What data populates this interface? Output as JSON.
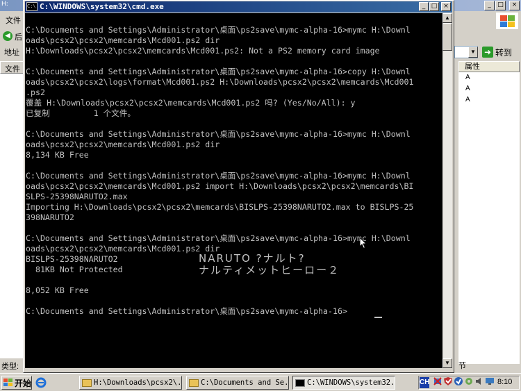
{
  "background_window": {
    "title_fragment": "H:",
    "menu_fragment": "文件",
    "back_fragment": "后",
    "address_label": "地址",
    "file_column": "文件",
    "attr_column": "属性",
    "attr_values": [
      "A",
      "A",
      "A"
    ],
    "go_label": "转到",
    "type_label": "类型:",
    "status_fragment": "节",
    "controls": [
      "_",
      "□",
      "×"
    ]
  },
  "cmd_window": {
    "title": "C:\\WINDOWS\\system32\\cmd.exe",
    "controls": [
      "_",
      "□",
      "×"
    ],
    "lines": [
      "C:\\Documents and Settings\\Administrator\\桌面\\ps2save\\mymc-alpha-16>mymc H:\\Downl",
      "oads\\pcsx2\\pcsx2\\memcards\\Mcd001.ps2 dir",
      "H:\\Downloads\\pcsx2\\pcsx2\\memcards\\Mcd001.ps2: Not a PS2 memory card image",
      "",
      "C:\\Documents and Settings\\Administrator\\桌面\\ps2save\\mymc-alpha-16>copy H:\\Downl",
      "oads\\pcsx2\\pcsx2\\logs\\format\\Mcd001.ps2 H:\\Downloads\\pcsx2\\pcsx2\\memcards\\Mcd001",
      ".ps2",
      "覆盖 H:\\Downloads\\pcsx2\\pcsx2\\memcards\\Mcd001.ps2 吗? (Yes/No/All): y",
      "已复制         1 个文件。",
      "",
      "C:\\Documents and Settings\\Administrator\\桌面\\ps2save\\mymc-alpha-16>mymc H:\\Downl",
      "oads\\pcsx2\\pcsx2\\memcards\\Mcd001.ps2 dir",
      "8,134 KB Free",
      "",
      "C:\\Documents and Settings\\Administrator\\桌面\\ps2save\\mymc-alpha-16>mymc H:\\Downl",
      "oads\\pcsx2\\pcsx2\\memcards\\Mcd001.ps2 import H:\\Downloads\\pcsx2\\pcsx2\\memcards\\BI",
      "SLPS-25398NARUTO2.max",
      "Importing H:\\Downloads\\pcsx2\\pcsx2\\memcards\\BISLPS-25398NARUTO2.max to BISLPS-25",
      "398NARUTO2",
      "",
      "C:\\Documents and Settings\\Administrator\\桌面\\ps2save\\mymc-alpha-16>mymc H:\\Downl",
      "oads\\pcsx2\\pcsx2\\memcards\\Mcd001.ps2 dir",
      "BISLPS-25398NARUTO2",
      "  81KB Not Protected",
      "",
      "8,052 KB Free",
      "",
      "C:\\Documents and Settings\\Administrator\\桌面\\ps2save\\mymc-alpha-16>"
    ],
    "save_title_line1": "NARUTO ?ナルト?",
    "save_title_line2": "ナルティメットヒーロー２"
  },
  "taskbar": {
    "start_label": "开始",
    "tasks": [
      "H:\\Downloads\\pcsx2\\...",
      "C:\\Documents and Se...",
      "C:\\WINDOWS\\system32..."
    ],
    "lang_indicator": "CH",
    "clock": "8:10"
  },
  "colors": {
    "console_bg": "#000000",
    "console_text": "#c0c0c0",
    "titlebar_active": "#0a246a",
    "titlebar_inactive": "#7a96c2",
    "window_face": "#d4d0c8"
  }
}
